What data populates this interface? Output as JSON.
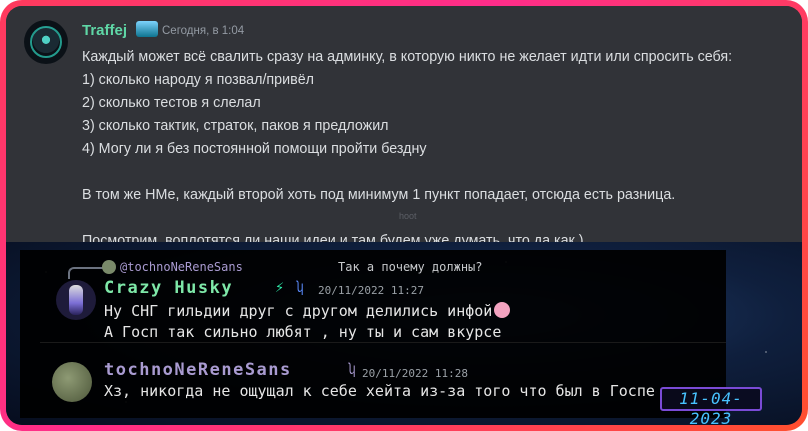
{
  "post": {
    "username": "Traffej",
    "timestamp": "Сегодня, в 1:04",
    "lines": [
      "Каждый может всё свалить сразу на админку, в которую никто не желает идти или спросить себя:",
      "1) сколько народу я позвал/привёл",
      "2) сколько тестов я слелал",
      "3) сколько тактик, страток, паков я предложил",
      "4) Могу ли я без постоянной помощи пройти бездну",
      "",
      "В том же НМе, каждый второй хоть под минимум 1 пункт попадает, отсюда есть разница.",
      "",
      "Посмотрим, воплотятся ли наши идеи и там будем уже думать, что да как )"
    ],
    "faint": "hoot"
  },
  "screenshot": {
    "reply": {
      "name": "@tochnoNeReneSans",
      "text": "Так а почему должны?"
    },
    "msg1": {
      "name": "Crazy Husky",
      "time": "20/11/2022 11:27",
      "lines": [
        "Ну СНГ гильдии друг с другом делились инфой",
        "А Госп так сильно любят , ну ты и сам вкурсе"
      ]
    },
    "msg2": {
      "name": "tochnoNeReneSans",
      "time": "20/11/2022 11:28",
      "text": "Хз, никогда не ощущал к себе хейта из-за того что был в Госпе"
    },
    "date_stamp": "11-04-2023"
  },
  "icons": {
    "bolt": "⚡",
    "husky": "ʮ"
  }
}
